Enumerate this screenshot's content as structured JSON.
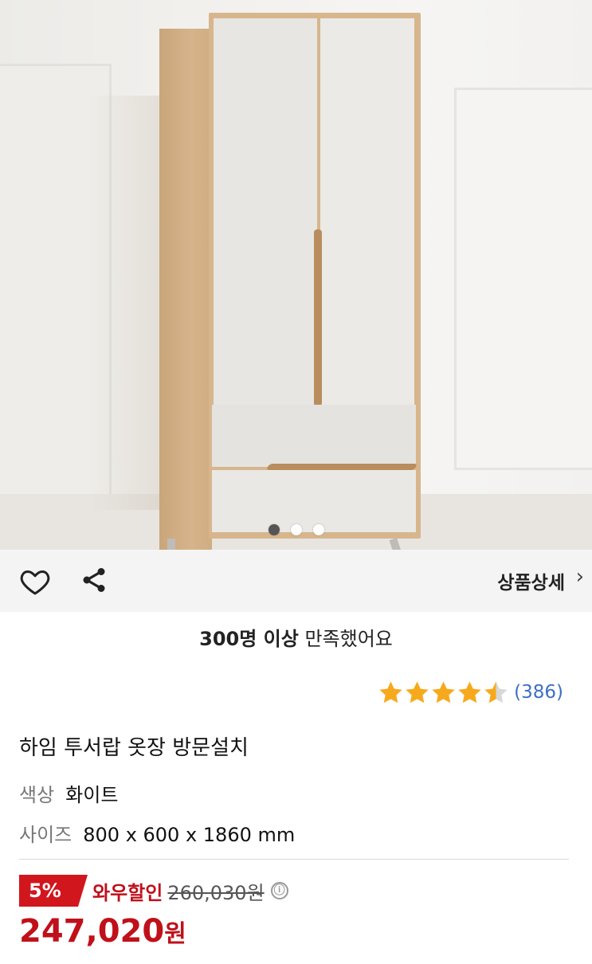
{
  "carousel": {
    "total": 3,
    "active": 1
  },
  "actions": {
    "detail_label": "상품상세",
    "detail_chevron": "›"
  },
  "satisfaction": {
    "bold": "300명 이상",
    "rest": " 만족했어요"
  },
  "rating": {
    "stars": 4.5,
    "count": "(386)",
    "color": "#f7a91d"
  },
  "product": {
    "title": "하임 투서랍 옷장 방문설치",
    "color_key": "색상",
    "color_value": "화이트",
    "size_key": "사이즈",
    "size_value": "800 x 600 x 1860 mm"
  },
  "pricing": {
    "discount_rate": "5%",
    "discount_label": "와우할인",
    "original_price": "260,030원",
    "info_icon": "ⓘ",
    "sale_price": "247,020",
    "currency": "원",
    "accent": "#c0101a"
  },
  "icons": [
    "heart-icon",
    "share-icon",
    "chevron-right-icon",
    "star-icon",
    "info-icon"
  ]
}
